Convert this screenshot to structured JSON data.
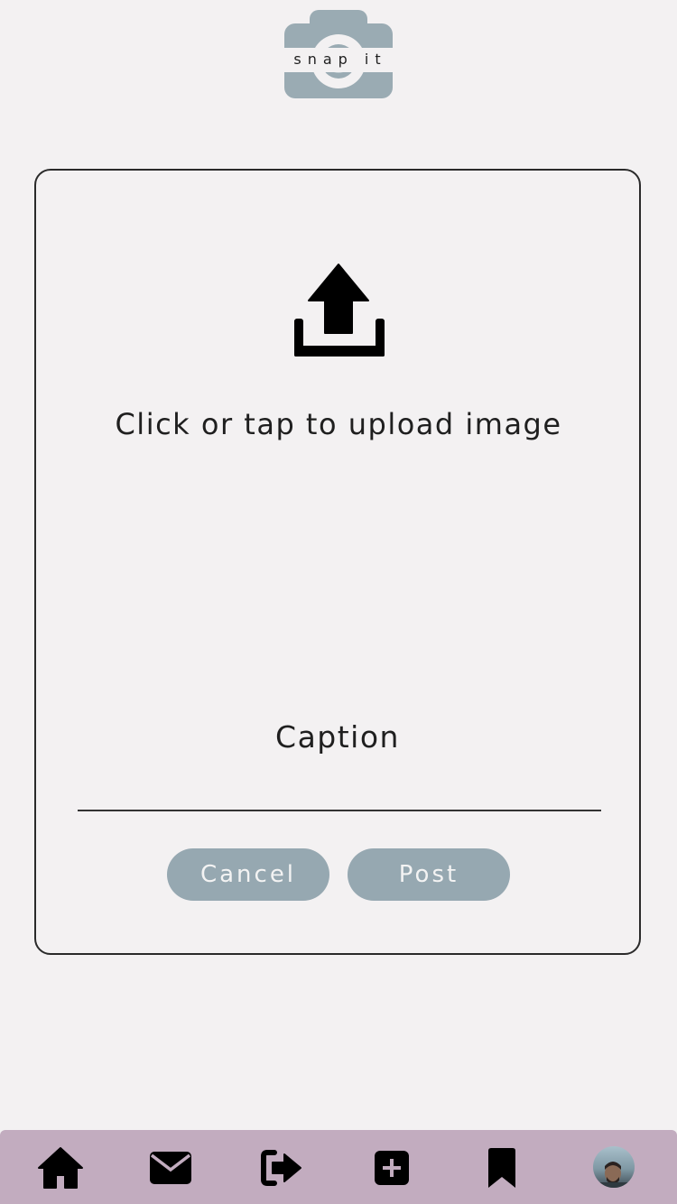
{
  "app": {
    "logo_text": "snap it",
    "brand_color": "#96a8b1"
  },
  "upload": {
    "icon": "upload-icon",
    "prompt": "Click or tap to upload image"
  },
  "caption": {
    "label": "Caption",
    "value": "",
    "placeholder": ""
  },
  "actions": {
    "cancel_label": "Cancel",
    "post_label": "Post"
  },
  "nav": {
    "background": "#c2acbf",
    "items": [
      {
        "icon": "home-icon"
      },
      {
        "icon": "envelope-icon"
      },
      {
        "icon": "sign-out-icon"
      },
      {
        "icon": "plus-square-icon"
      },
      {
        "icon": "bookmark-icon"
      },
      {
        "icon": "profile-avatar"
      }
    ]
  }
}
